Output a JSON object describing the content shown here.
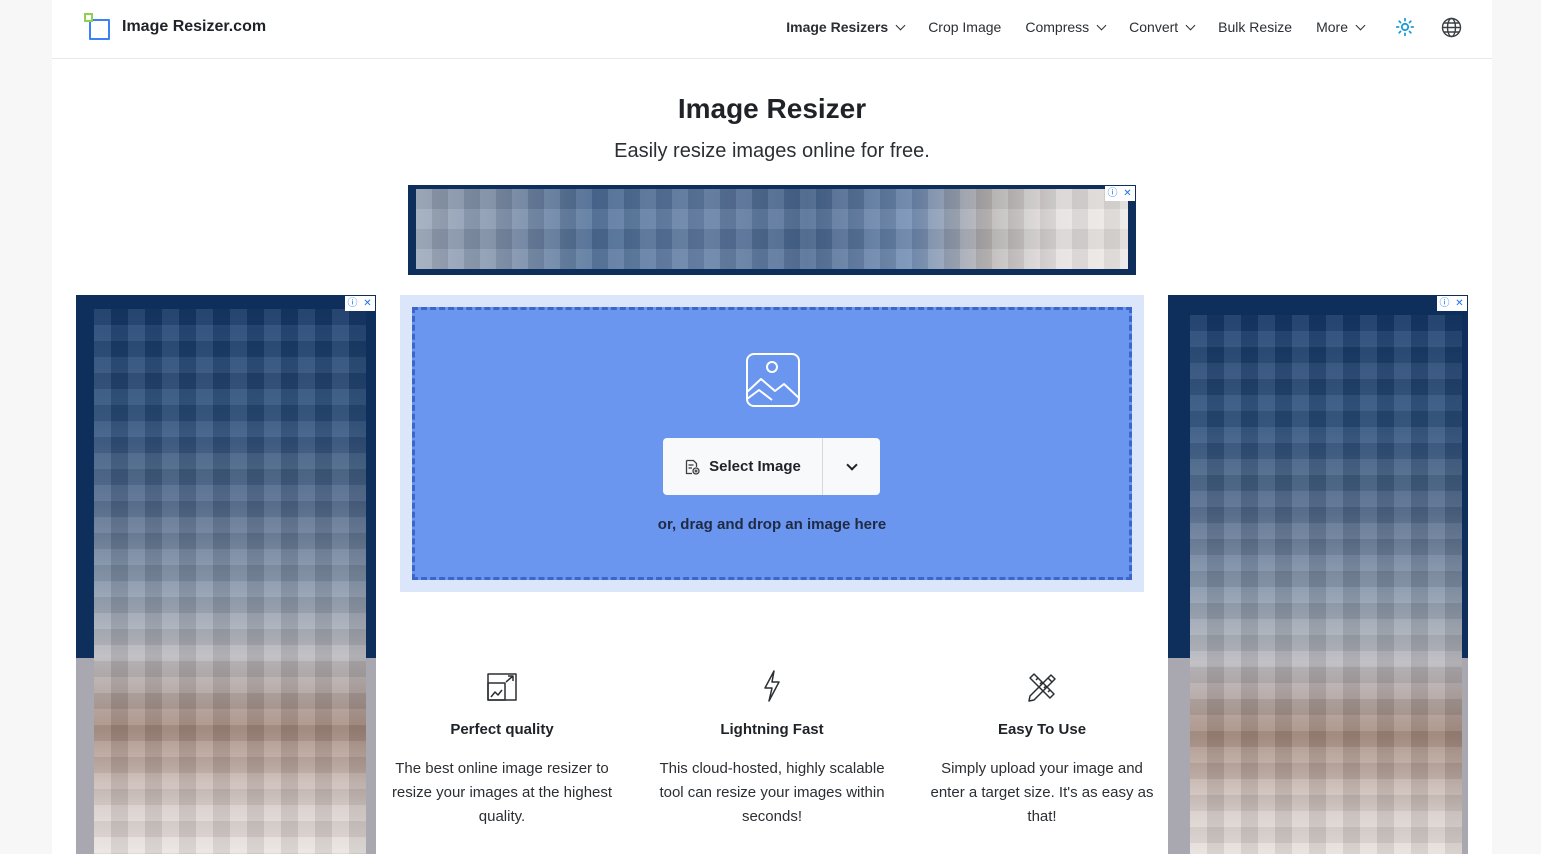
{
  "brand": {
    "name": "Image Resizer.com",
    "logo_icon": "resize-squares-icon",
    "accent_color": "#3b82f6",
    "logo_green": "#8fd14f"
  },
  "nav": {
    "items": [
      {
        "label": "Image Resizers",
        "has_dropdown": true,
        "active": true
      },
      {
        "label": "Crop Image",
        "has_dropdown": false
      },
      {
        "label": "Compress",
        "has_dropdown": true
      },
      {
        "label": "Convert",
        "has_dropdown": true
      },
      {
        "label": "Bulk Resize",
        "has_dropdown": false
      },
      {
        "label": "More",
        "has_dropdown": true
      }
    ],
    "theme_icon": "sun-icon",
    "language_icon": "globe-icon"
  },
  "hero": {
    "title": "Image Resizer",
    "subtitle": "Easily resize images online for free."
  },
  "upload": {
    "select_label": "Select Image",
    "drag_hint": "or, drag and drop an image here",
    "zone_color": "#6b96f0"
  },
  "features": [
    {
      "icon": "resize-frame-icon",
      "title": "Perfect quality",
      "description": "The best online image resizer to resize your images at the highest quality."
    },
    {
      "icon": "lightning-icon",
      "title": "Lightning Fast",
      "description": "This cloud-hosted, highly scalable tool can resize your images within seconds!"
    },
    {
      "icon": "pencil-ruler-icon",
      "title": "Easy To Use",
      "description": "Simply upload your image and enter a target size. It's as easy as that!"
    }
  ]
}
